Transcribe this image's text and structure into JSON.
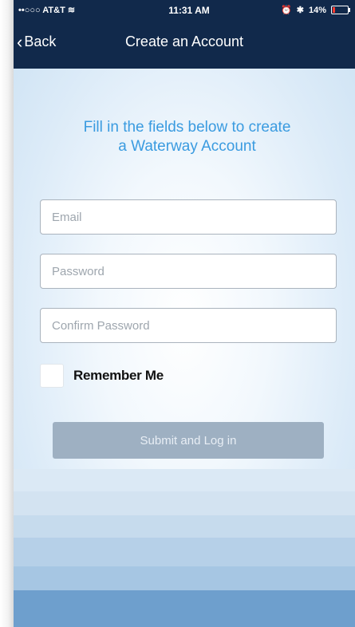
{
  "status_bar": {
    "carrier": "••○○○ AT&T ≋",
    "time": "11:31 AM",
    "battery_text": "14%"
  },
  "nav": {
    "back_label": "Back",
    "title": "Create an Account"
  },
  "form": {
    "headline_line1": "Fill in the fields below to create",
    "headline_line2": "a Waterway Account",
    "email_placeholder": "Email",
    "password_placeholder": "Password",
    "confirm_placeholder": "Confirm Password",
    "remember_label": "Remember Me",
    "submit_label": "Submit and Log in"
  },
  "colors": {
    "nav_background": "#11294b",
    "headline": "#3a9be0",
    "submit_disabled": "#9eb0c2"
  }
}
